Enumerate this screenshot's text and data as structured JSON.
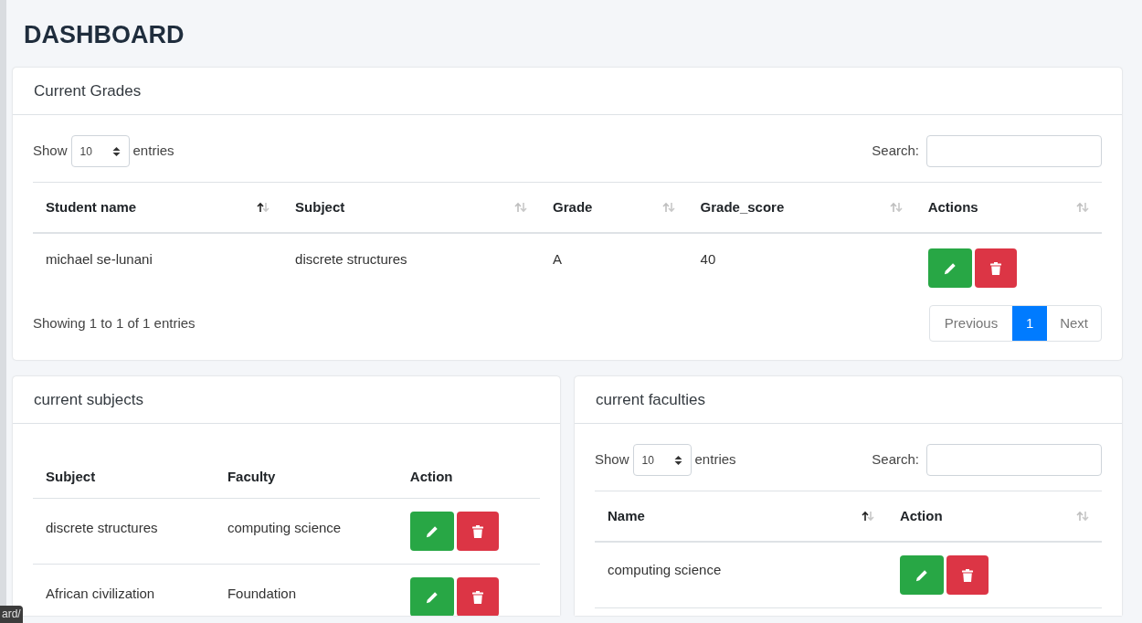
{
  "page_title": "DASHBOARD",
  "grades": {
    "title": "Current Grades",
    "length": {
      "before": "Show",
      "value": "10",
      "after": "entries"
    },
    "search_label": "Search:",
    "columns": [
      {
        "label": "Student name",
        "sorted": true
      },
      {
        "label": "Subject",
        "sorted": false
      },
      {
        "label": "Grade",
        "sorted": false
      },
      {
        "label": "Grade_score",
        "sorted": false
      },
      {
        "label": "Actions",
        "sorted": false
      }
    ],
    "rows": [
      {
        "cells": [
          "michael se-lunani",
          "discrete structures",
          "A",
          "40"
        ]
      }
    ],
    "info": "Showing 1 to 1 of 1 entries",
    "pagination": {
      "previous": "Previous",
      "pages": [
        {
          "label": "1",
          "selected": true
        }
      ],
      "next": "Next"
    }
  },
  "subjects": {
    "title": "current subjects",
    "columns": [
      "Subject",
      "Faculty",
      "Action"
    ],
    "rows": [
      {
        "cells": [
          "discrete structures",
          "computing science"
        ]
      },
      {
        "cells": [
          "African civilization",
          "Foundation"
        ]
      }
    ]
  },
  "faculties": {
    "title": "current faculties",
    "length": {
      "before": "Show",
      "value": "10",
      "after": "entries"
    },
    "search_label": "Search:",
    "columns": [
      {
        "label": "Name",
        "sorted": true
      },
      {
        "label": "Action",
        "sorted": false
      }
    ],
    "rows": [
      {
        "cells": [
          "computing science"
        ]
      }
    ]
  },
  "status_url": "ard/"
}
